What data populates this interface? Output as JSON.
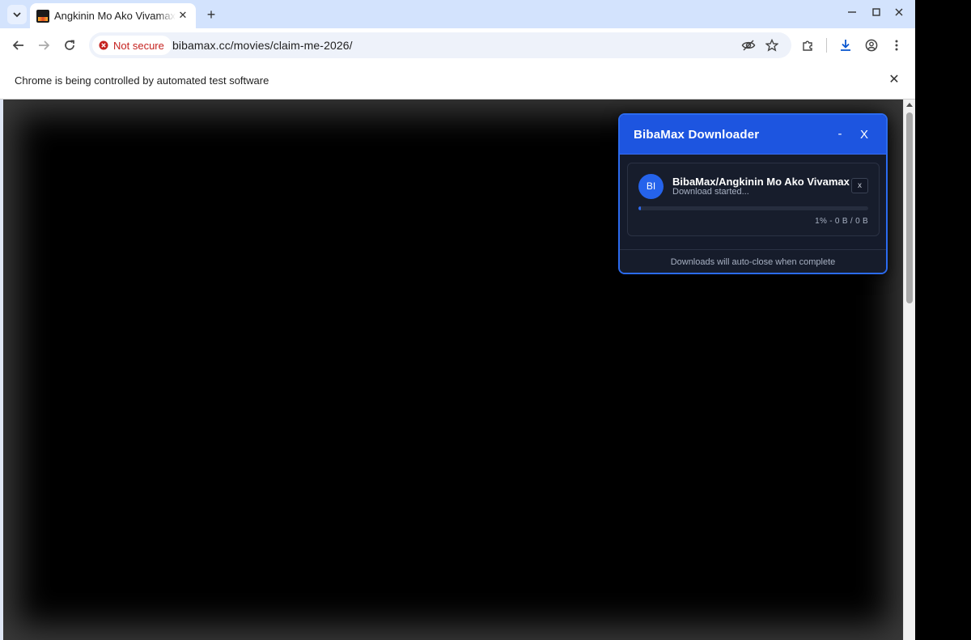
{
  "browser": {
    "tab": {
      "title": "Angkinin Mo Ako Vivamax",
      "close_glyph": "✕"
    },
    "new_tab_glyph": "+",
    "window_controls": {
      "minimize": "—",
      "maximize": "☐",
      "close": "✕"
    },
    "omnibox": {
      "security_label": "Not secure",
      "url": "bibamax.cc/movies/claim-me-2026/"
    },
    "infobar": {
      "message": "Chrome is being controlled by automated test software",
      "close_glyph": "✕"
    }
  },
  "downloader": {
    "title": "BibaMax Downloader",
    "minimize_label": "-",
    "close_label": "X",
    "item": {
      "avatar_initials": "BI",
      "name": "BibaMax/Angkinin Mo Ako Vivamax",
      "status": "Download started...",
      "close_label": "x",
      "progress_percent": 1,
      "meta": "1% - 0 B / 0 B"
    },
    "footer": "Downloads will auto-close when complete"
  },
  "colors": {
    "accent": "#1d55e0",
    "panel_bg": "#151b2b",
    "insecure_red": "#c5221f"
  }
}
